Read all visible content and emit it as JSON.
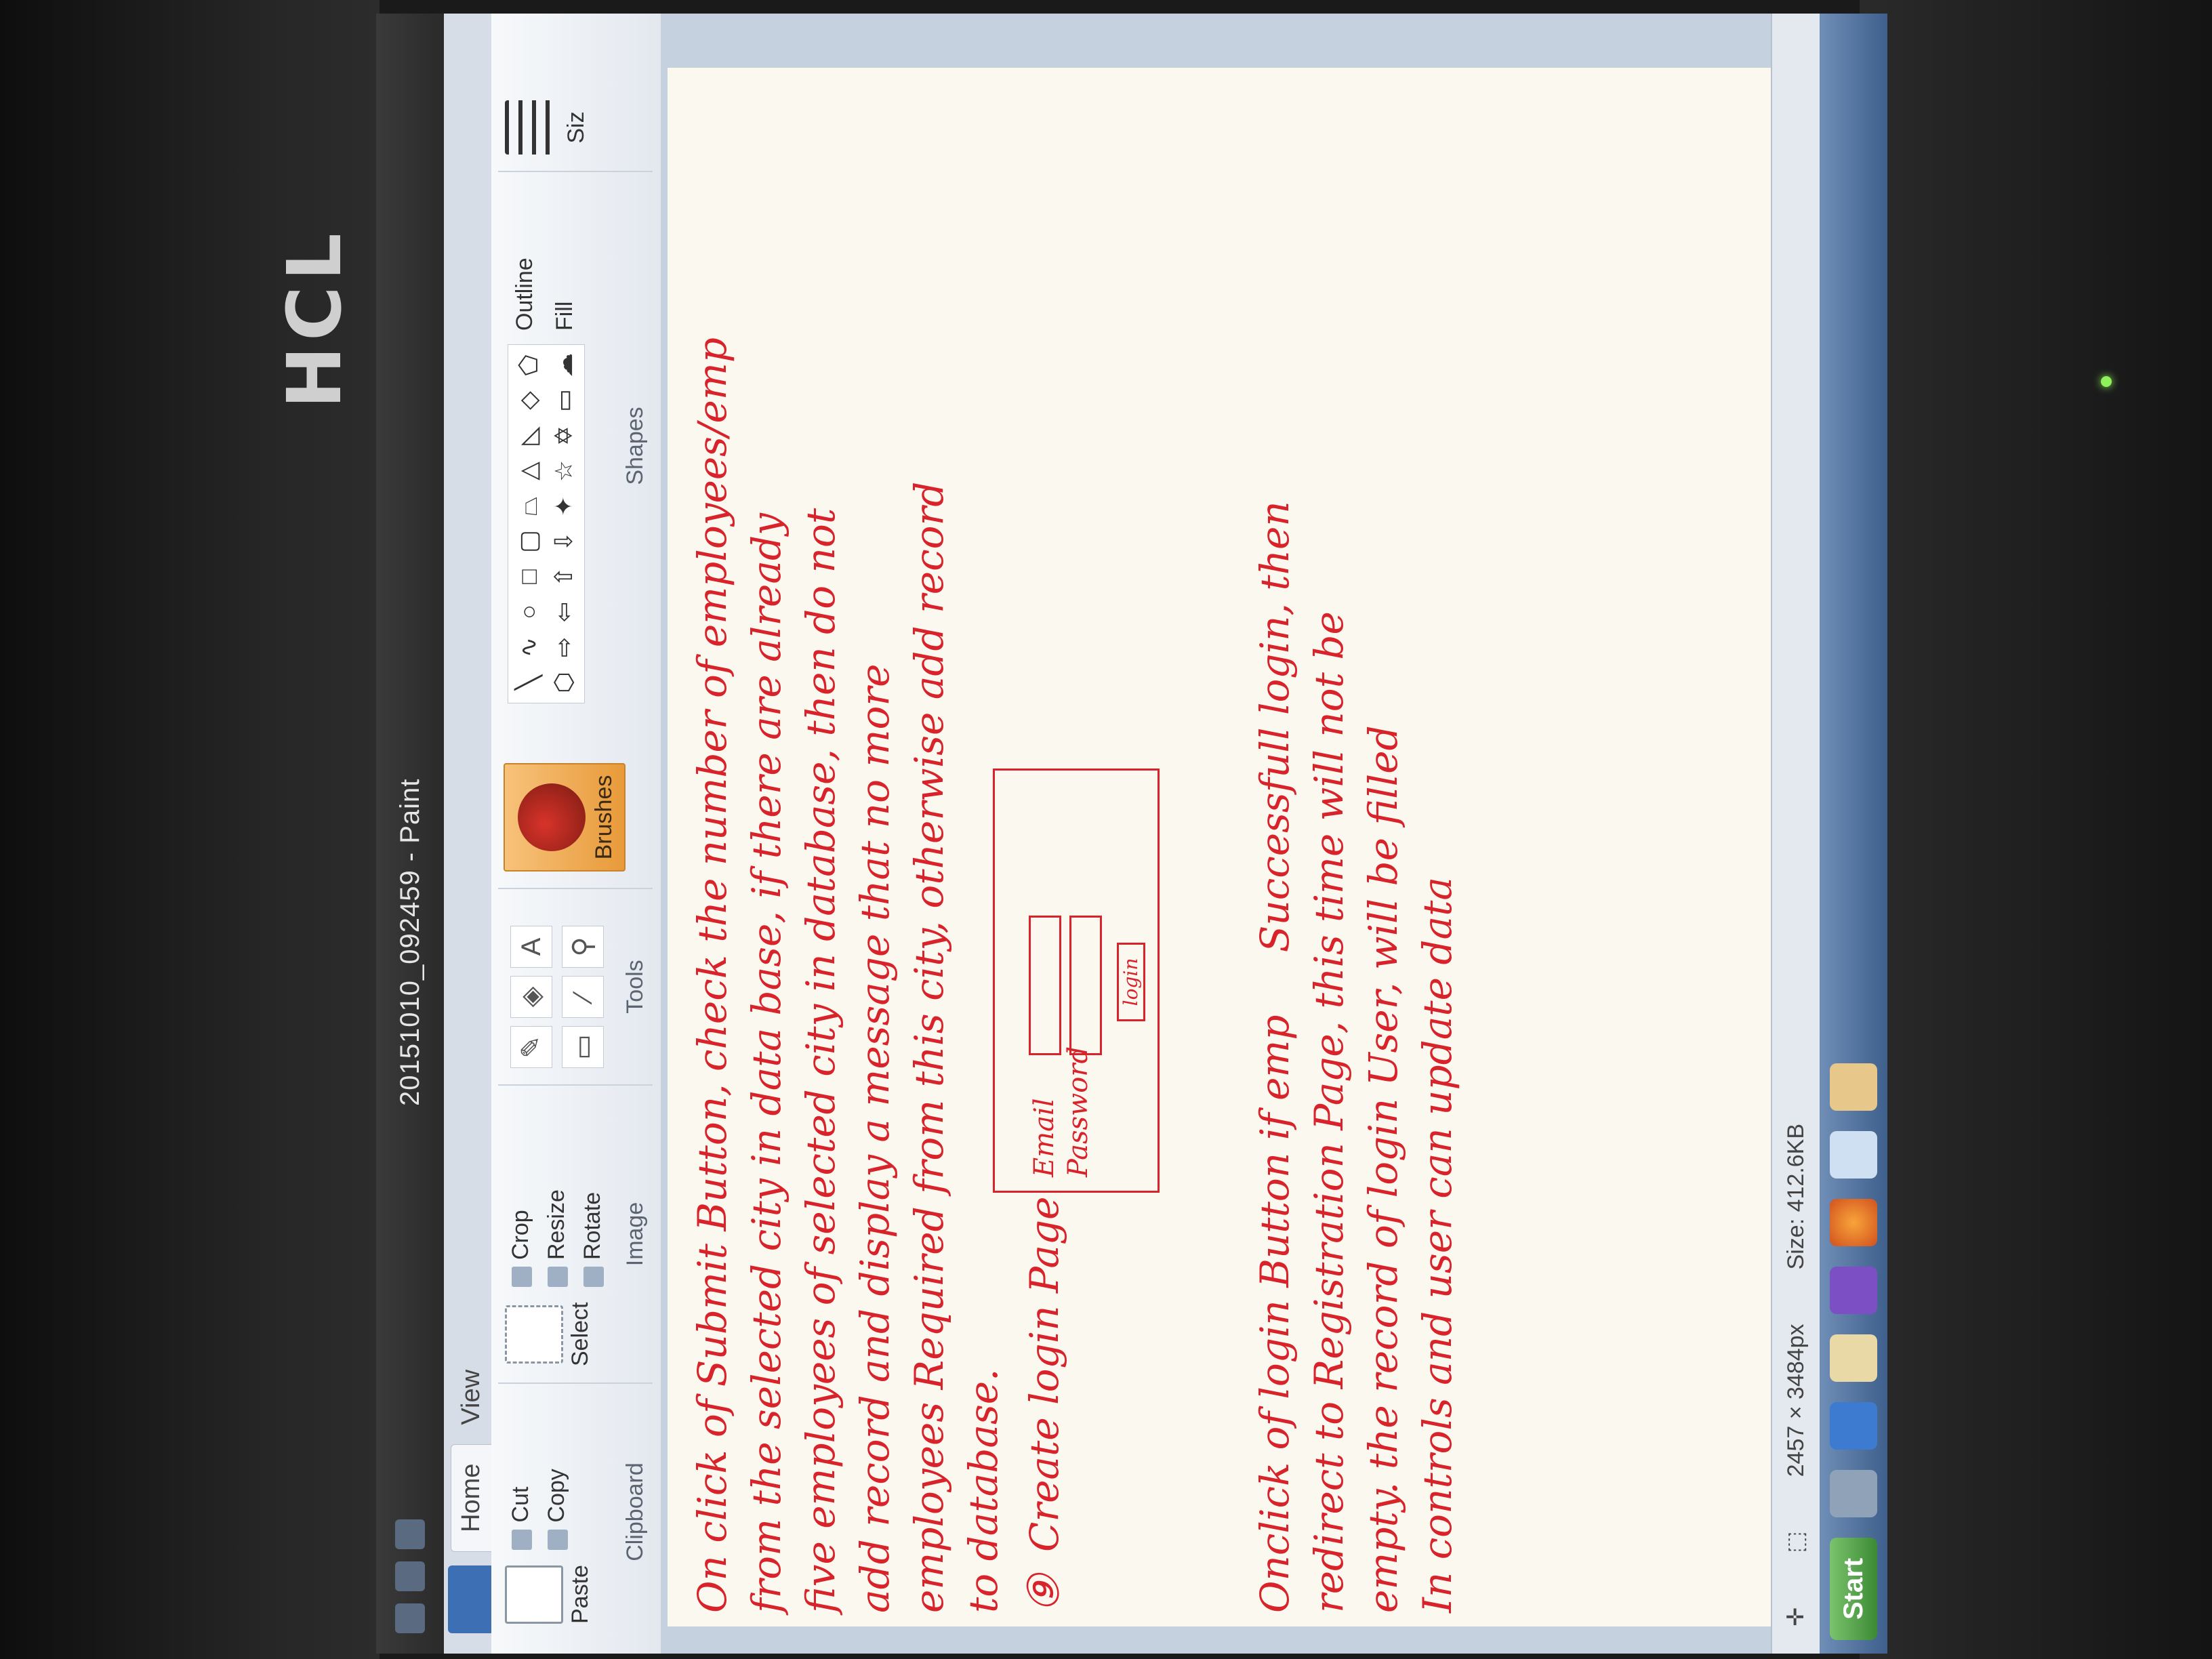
{
  "monitor": {
    "brand": "HCL"
  },
  "window": {
    "title": "20151010_092459 - Paint"
  },
  "tabs": [
    "Home",
    "View"
  ],
  "ribbon": {
    "clipboard": {
      "label": "Clipboard",
      "paste": "Paste",
      "cut": "Cut",
      "copy": "Copy"
    },
    "image": {
      "label": "Image",
      "select": "Select",
      "crop": "Crop",
      "resize": "Resize",
      "rotate": "Rotate"
    },
    "tools": {
      "label": "Tools"
    },
    "brushes": {
      "label": "Brushes"
    },
    "shapes": {
      "label": "Shapes",
      "outline": "Outline",
      "fill": "Fill"
    },
    "size": {
      "label": "Siz"
    }
  },
  "note": {
    "line1": "On click of Submit Button, check the number of employees/emp",
    "line2": "from the selected city in data base, if there are already",
    "line3": "five employees of selected city in database, then do not",
    "line4": "add record and display a message that no more",
    "line5": "employees Required from this city, otherwise add record",
    "line6": "to database.",
    "item_number": "⑨",
    "item_title": "Create login Page",
    "login_email": "Email",
    "login_password": "Password",
    "login_button": "login",
    "para2_line1": "Onclick of login Button if emp     Successfull login, then",
    "para2_line2": "redirect to Registration Page, this time will not be",
    "para2_line3": "empty. the record of login User, will be filled",
    "para2_line4": "In controls and user can update data"
  },
  "status": {
    "dimensions": "2457 × 3484px",
    "size": "Size: 412.6KB"
  },
  "taskbar": {
    "start": "Start"
  }
}
